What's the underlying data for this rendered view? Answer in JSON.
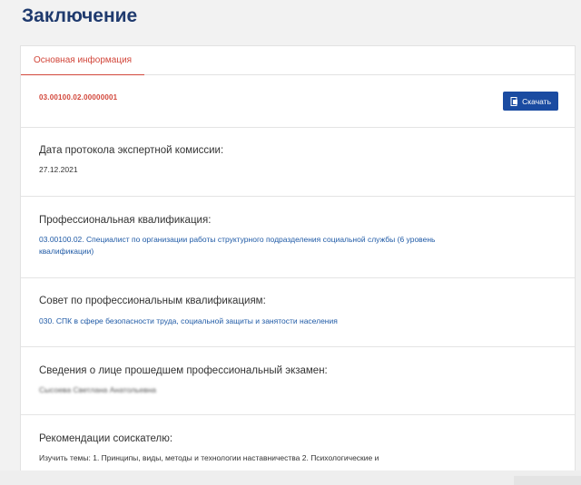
{
  "page": {
    "title": "Заключение"
  },
  "tabs": [
    {
      "label": "Основная информация",
      "active": true
    }
  ],
  "document": {
    "id": "03.00100.02.00000001",
    "download_label": "Скачать"
  },
  "fields": {
    "protocol_date": {
      "label": "Дата протокола экспертной комиссии:",
      "value": "27.12.2021"
    },
    "qualification": {
      "label": "Профессиональная квалификация:",
      "value": "03.00100.02. Специалист по организации работы структурного подразделения социальной службы (6 уровень квалификации)"
    },
    "council": {
      "label": "Совет по профессиональным квалификациям:",
      "value": "030. СПК в сфере безопасности труда, социальной защиты и занятости населения"
    },
    "person": {
      "label": "Сведения о лице прошедшем профессиональный экзамен:",
      "value": "Сысоева Светлана Анатольевна"
    },
    "recommendations": {
      "label": "Рекомендации соискателю:",
      "value": "Изучить темы: 1. Принципы, виды, методы и технологии наставничества 2. Психологические и"
    }
  },
  "colors": {
    "title": "#1f3a6e",
    "accent_red": "#d2463a",
    "button": "#1a4ba1",
    "link": "#1f5aa6"
  },
  "icons": {
    "download": "file-download-icon"
  }
}
